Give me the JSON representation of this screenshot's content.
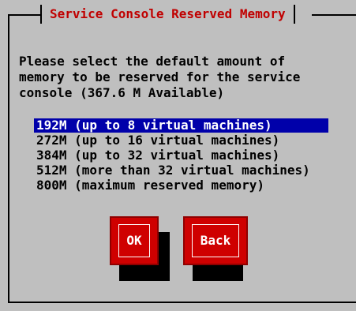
{
  "dialog": {
    "title": "Service Console Reserved Memory",
    "description": "Please select the default amount of\nmemory to be reserved for the service\nconsole (367.6 M Available)"
  },
  "memory_options": [
    {
      "label": "192M (up to 8 virtual machines)",
      "selected": true
    },
    {
      "label": "272M (up to 16 virtual machines)",
      "selected": false
    },
    {
      "label": "384M (up to 32 virtual machines)",
      "selected": false
    },
    {
      "label": "512M (more than 32 virtual machines)",
      "selected": false
    },
    {
      "label": "800M (maximum reserved memory)",
      "selected": false
    }
  ],
  "buttons": {
    "ok_label": "OK",
    "back_label": "Back"
  },
  "colors": {
    "background": "#bfbfbf",
    "title_text": "#c00000",
    "selection_bg": "#0000aa",
    "button_bg": "#cf0000"
  }
}
